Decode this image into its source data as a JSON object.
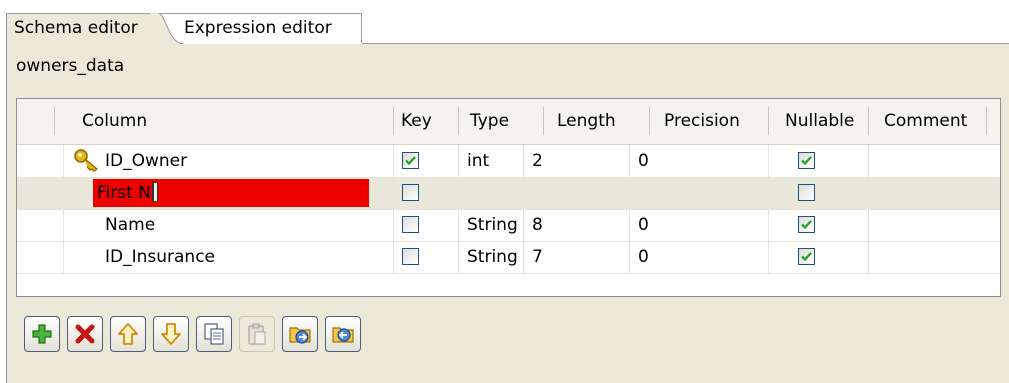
{
  "tabs": [
    {
      "label": "Schema editor",
      "active": true
    },
    {
      "label": "Expression editor",
      "active": false
    }
  ],
  "schema_name": "owners_data",
  "columns": [
    "Column",
    "Key",
    "Type",
    "Length",
    "Precision",
    "Nullable",
    "Comment"
  ],
  "rows": [
    {
      "column": "ID_Owner",
      "key": true,
      "type": "int",
      "length": "2",
      "precision": "0",
      "nullable": true,
      "comment": "",
      "primary_key_icon": "key-icon"
    },
    {
      "column": "First N",
      "key": false,
      "type": "",
      "length": "",
      "precision": "",
      "nullable": false,
      "comment": "",
      "editing": true
    },
    {
      "column": "Name",
      "key": false,
      "type": "String",
      "length": "8",
      "precision": "0",
      "nullable": true,
      "comment": ""
    },
    {
      "column": "ID_Insurance",
      "key": false,
      "type": "String",
      "length": "7",
      "precision": "0",
      "nullable": true,
      "comment": ""
    }
  ],
  "toolbar": [
    {
      "name": "add-button",
      "icon": "plus-icon",
      "enabled": true
    },
    {
      "name": "remove-button",
      "icon": "delete-x-icon",
      "enabled": true
    },
    {
      "name": "move-up-button",
      "icon": "arrow-up-icon",
      "enabled": true
    },
    {
      "name": "move-down-button",
      "icon": "arrow-down-icon",
      "enabled": true
    },
    {
      "name": "copy-button",
      "icon": "copy-icon",
      "enabled": true
    },
    {
      "name": "paste-button",
      "icon": "paste-icon",
      "enabled": false
    },
    {
      "name": "import-button",
      "icon": "import-icon",
      "enabled": true
    },
    {
      "name": "export-button",
      "icon": "export-icon",
      "enabled": true
    }
  ],
  "colors": {
    "editing_cell": "#ee0000",
    "panel": "#ece9d8",
    "check": "#21a121"
  }
}
